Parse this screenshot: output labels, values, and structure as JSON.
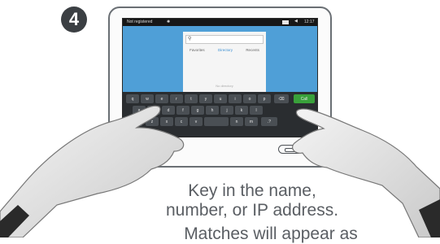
{
  "step": {
    "number": "4"
  },
  "statusbar": {
    "status": "Not registered",
    "time": "12:17"
  },
  "directory": {
    "search_placeholder": "",
    "tabs": [
      {
        "label": "Favorites",
        "active": false
      },
      {
        "label": "Directory",
        "active": true
      },
      {
        "label": "Recents",
        "active": false
      }
    ],
    "no_results": "No directory"
  },
  "keyboard": {
    "row1": [
      "q",
      "w",
      "e",
      "r",
      "t",
      "y",
      "u",
      "i",
      "o",
      "p"
    ],
    "row2": [
      "a",
      "s",
      "d",
      "f",
      "g",
      "h",
      "j",
      "k",
      "l"
    ],
    "row3": [
      "z",
      "x",
      "c",
      "v",
      "b",
      "n",
      "m"
    ],
    "call_label": "Call"
  },
  "caption": {
    "line1": "Key in the name,",
    "line2": "number, or IP address.",
    "line3": "Matches will appear as"
  },
  "colors": {
    "screen": "#4f9fd7",
    "call": "#39a13a",
    "badge": "#3b3f43"
  }
}
